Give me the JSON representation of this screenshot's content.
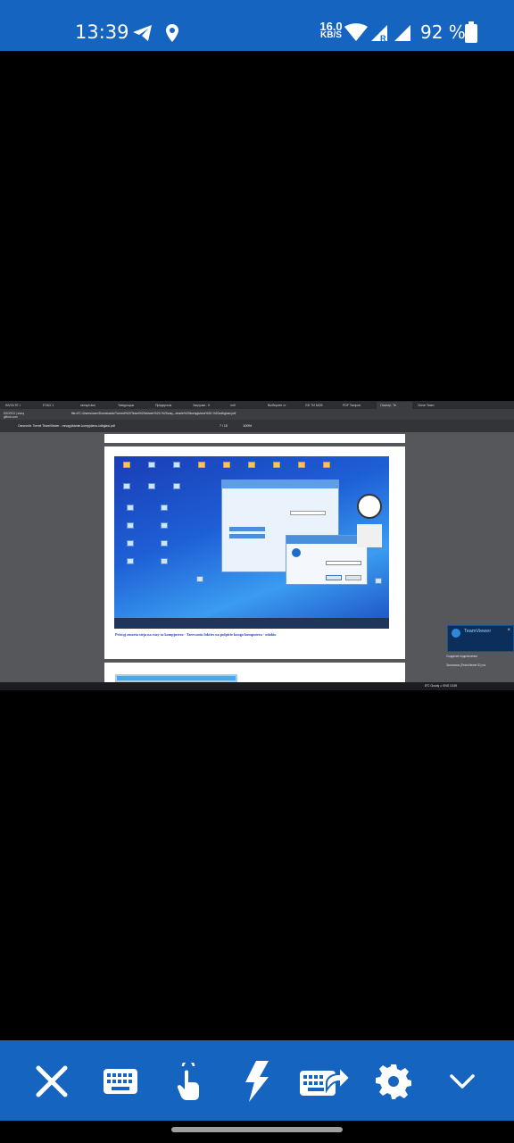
{
  "status_bar": {
    "time": "13:39",
    "speed_value": "16.0",
    "speed_unit": "KB/S",
    "network_letter": "R",
    "battery_percent": "92 %"
  },
  "remote": {
    "browser_tabs": [
      {
        "label": "INVOLTE t"
      },
      {
        "label": "ETAG 1"
      },
      {
        "label": "slonq/ruks/"
      },
      {
        "label": "Тимуроцык"
      },
      {
        "label": "Предпросм"
      },
      {
        "label": "Загрузки - К"
      },
      {
        "label": "nofi"
      },
      {
        "label": "Выберите ст"
      },
      {
        "label": "GD ТИ МОБ"
      },
      {
        "label": "PDF Tampon"
      },
      {
        "label": "Осмотр. Те"
      },
      {
        "label": "Close Team"
      }
    ],
    "url": "file:///C:/Users/user/Downloads/Turned%20Team%20viewer%20-%20zaq...zbarie%20kompjutera%20-%20odbglasi.pdf",
    "side_info": {
      "line1": "ЕКОЛОЗ | slonq",
      "line2": "github.com"
    },
    "pdf_title": "Osnovnitr. Tornet TeamViewer - mnogyikamie-kompjutera-odbglasi.pdf",
    "pdf_page": "7 / 15",
    "pdf_zoom": "100%",
    "caption": "Pristąj zmoeta sieja na ruzy ta kompjutera - Tarewonis foktirs na pulpicie kongo komputera - odabio",
    "teamviewer_popup": {
      "title": "TeamViewer",
      "line1": "Создание подключения",
      "line2": "Заголовок (TeamViewer ID) на"
    },
    "win_tray": "8°C Cloudy   ∧  ENG  13:39"
  },
  "toolbar": {
    "buttons": [
      {
        "name": "close",
        "icon": "close-icon"
      },
      {
        "name": "keyboard",
        "icon": "keyboard-icon"
      },
      {
        "name": "touch",
        "icon": "touch-icon"
      },
      {
        "name": "actions",
        "icon": "lightning-icon"
      },
      {
        "name": "send-keys",
        "icon": "keyboard-send-icon"
      },
      {
        "name": "settings",
        "icon": "gear-icon"
      },
      {
        "name": "collapse",
        "icon": "chevron-down-icon"
      }
    ]
  },
  "colors": {
    "accent": "#1565c0",
    "background": "#000000",
    "nav_pill": "#9e9e9e"
  }
}
